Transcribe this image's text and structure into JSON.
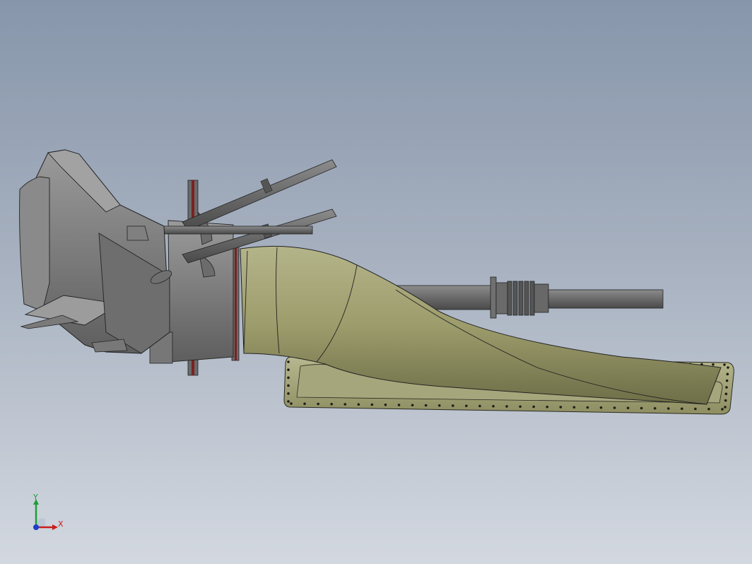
{
  "viewport": {
    "background_top": "#8796ab",
    "background_bottom": "#d3d8e0"
  },
  "model": {
    "body_color": "#8a8a8a",
    "body_dark": "#5a5a5a",
    "duct_color": "#a9a97a",
    "duct_dark": "#6e6e48",
    "flange_color": "#7a2222",
    "edge_color": "#222222"
  },
  "triad": {
    "x_label": "X",
    "y_label": "Y",
    "x_color": "#c81e1e",
    "y_color": "#1e9e3a",
    "z_color": "#1e3cc8"
  }
}
